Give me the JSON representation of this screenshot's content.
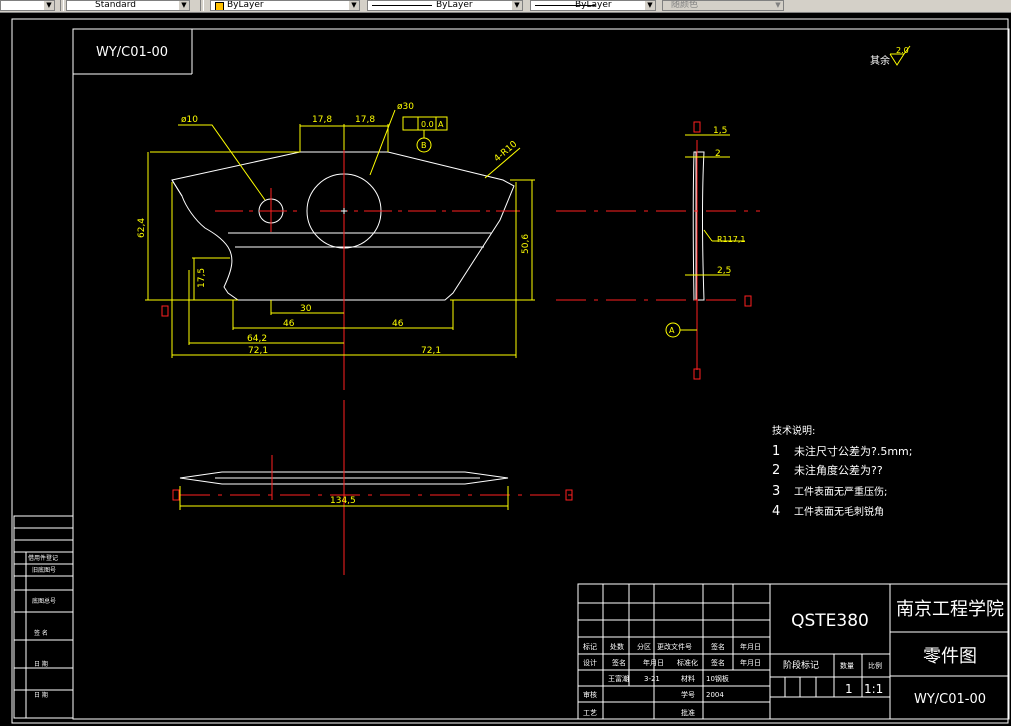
{
  "toolbar": {
    "text_style": "Standard",
    "layer_color": "ByLayer",
    "linetype": "ByLayer",
    "lineweight": "ByLayer",
    "plot_style": "随颜色"
  },
  "drawing": {
    "code_box": "WY/C01-00",
    "surface_roughness_note": "其余",
    "roughness_value": "2.0",
    "dims": {
      "dia_small": "ø10",
      "dia_large": "ø30",
      "h17_8_a": "17,8",
      "h17_8_b": "17,8",
      "chamfer": "4-R10",
      "tol_flat": "0.0",
      "tol_datum": "A",
      "datum_b": "B",
      "v62_4": "62,4",
      "v17_5": "17,5",
      "v50_6": "50,6",
      "h30": "30",
      "h46a": "46",
      "h46b": "46",
      "h64_2": "64,2",
      "h72_1a": "72,1",
      "h72_1b": "72,1",
      "t1_5": "1,5",
      "t2": "2",
      "r117": "R117,1",
      "t2_5": "2,5",
      "datum_a": "A",
      "h134_5": "134,5"
    },
    "tech_notes": {
      "title": "技术说明:",
      "items": [
        {
          "num": "1",
          "text": "未注尺寸公差为?.5mm;"
        },
        {
          "num": "2",
          "text": "未注角度公差为??"
        },
        {
          "num": "3",
          "text": "工件表面无严重压伤;"
        },
        {
          "num": "4",
          "text": "工件表面无毛刺锐角"
        }
      ]
    },
    "left_strip": [
      "借用件登记",
      "旧底图号",
      "底图总号",
      "签  名",
      "日  期",
      "签  名",
      "日  期"
    ],
    "title_block": {
      "part_code": "QSTE380",
      "school": "南京工程学院",
      "drawing_name": "零件图",
      "drawing_no": "WY/C01-00",
      "row_headers": [
        "标记",
        "处数",
        "分区",
        "更改文件号",
        "签名",
        "年月日"
      ],
      "row_design": [
        "设计",
        "签名",
        "年月日",
        "标准化",
        "签名",
        "年月日"
      ],
      "row_names": [
        "王富潮",
        "3-21",
        "材料",
        "10钢板"
      ],
      "row_review": [
        "审核",
        "学号",
        "2004"
      ],
      "row_process": [
        "工艺",
        "批准"
      ],
      "stage_label": "阶段标记",
      "qty_label": "数量",
      "scale_label": "比例",
      "qty_value": "1",
      "scale_value": "1:1"
    }
  }
}
